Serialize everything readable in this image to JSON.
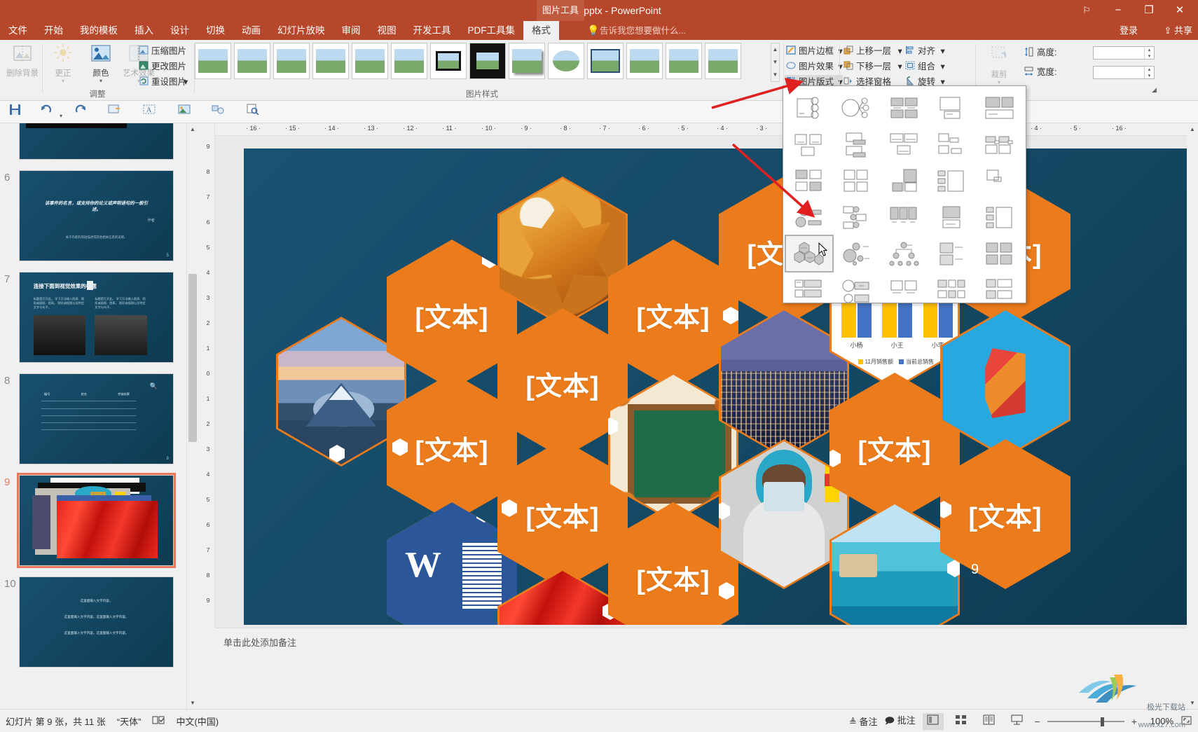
{
  "window": {
    "title": "PPT教程2.pptx - PowerPoint",
    "context_tab": "图片工具",
    "flag_icon": "flag-icon",
    "minimize": "−",
    "restore": "❐",
    "close": "✕"
  },
  "tabs": [
    {
      "label": "文件",
      "active": false
    },
    {
      "label": "开始",
      "active": false
    },
    {
      "label": "我的模板",
      "active": false
    },
    {
      "label": "插入",
      "active": false
    },
    {
      "label": "设计",
      "active": false
    },
    {
      "label": "切换",
      "active": false
    },
    {
      "label": "动画",
      "active": false
    },
    {
      "label": "幻灯片放映",
      "active": false
    },
    {
      "label": "审阅",
      "active": false
    },
    {
      "label": "视图",
      "active": false
    },
    {
      "label": "开发工具",
      "active": false
    },
    {
      "label": "PDF工具集",
      "active": false
    },
    {
      "label": "格式",
      "active": true
    }
  ],
  "tellme": "告诉我您想要做什么...",
  "account": "登录",
  "share": "共享",
  "share_icon": "share-icon",
  "ribbon": {
    "adjust_group": {
      "label": "调整",
      "remove_bg": {
        "label": "删除背景",
        "icon": "remove-background-icon"
      },
      "corrections": {
        "label": "更正",
        "icon": "corrections-icon"
      },
      "color": {
        "label": "颜色",
        "icon": "color-icon"
      },
      "artistic": {
        "label": "艺术效果",
        "icon": "artistic-effects-icon"
      },
      "compress": {
        "label": "压缩图片",
        "icon": "compress-picture-icon"
      },
      "change": {
        "label": "更改图片",
        "icon": "change-picture-icon"
      },
      "reset": {
        "label": "重设图片",
        "icon": "reset-picture-icon"
      }
    },
    "styles_group": {
      "label": "图片样式",
      "count": 14
    },
    "effects_group": {
      "border": {
        "label": "图片边框",
        "icon": "picture-border-icon"
      },
      "effects": {
        "label": "图片效果",
        "icon": "picture-effects-icon"
      },
      "layout": {
        "label": "图片版式",
        "icon": "picture-layout-icon",
        "active": true
      }
    },
    "arrange_group": {
      "bring_forward": {
        "label": "上移一层",
        "icon": "bring-forward-icon"
      },
      "send_backward": {
        "label": "下移一层",
        "icon": "send-backward-icon"
      },
      "selection_pane": {
        "label": "选择窗格",
        "icon": "selection-pane-icon"
      },
      "align": {
        "label": "对齐",
        "icon": "align-icon"
      },
      "group": {
        "label": "组合",
        "icon": "group-icon"
      },
      "rotate": {
        "label": "旋转",
        "icon": "rotate-icon"
      }
    },
    "size_group": {
      "crop": {
        "label": "裁剪",
        "icon": "crop-icon"
      },
      "height": {
        "label": "高度:",
        "value": "",
        "icon": "height-icon"
      },
      "width": {
        "label": "宽度:",
        "value": "",
        "icon": "width-icon"
      }
    }
  },
  "qat": [
    {
      "icon": "save-icon",
      "name": "save"
    },
    {
      "icon": "undo-icon",
      "name": "undo"
    },
    {
      "icon": "redo-icon",
      "name": "redo"
    },
    {
      "icon": "new-slide-icon",
      "name": "new-slide"
    },
    {
      "icon": "text-box-icon",
      "name": "text-box"
    },
    {
      "icon": "picture-icon",
      "name": "insert-picture"
    },
    {
      "icon": "shapes-icon",
      "name": "shapes"
    },
    {
      "icon": "preview-icon",
      "name": "print-preview"
    }
  ],
  "layout_dropdown": {
    "name": "picture-layout-gallery",
    "selected_index": 20,
    "items": [
      {
        "name": "accented-picture",
        "kind": "a"
      },
      {
        "name": "circular-picture-callout",
        "kind": "b"
      },
      {
        "name": "snapshot-picture-list",
        "kind": "c"
      },
      {
        "name": "picture-caption-list",
        "kind": "d"
      },
      {
        "name": "bending-picture-accent-list",
        "kind": "e"
      },
      {
        "name": "picture-strips",
        "kind": "f"
      },
      {
        "name": "captioned-pictures",
        "kind": "g"
      },
      {
        "name": "titled-picture-accent-list",
        "kind": "h"
      },
      {
        "name": "bubble-picture-list",
        "kind": "i"
      },
      {
        "name": "picture-accent-blocks",
        "kind": "j"
      },
      {
        "name": "alternating-picture-blocks",
        "kind": "k"
      },
      {
        "name": "picture-grid",
        "kind": "l"
      },
      {
        "name": "picture-lineup",
        "kind": "m"
      },
      {
        "name": "spiral-picture",
        "kind": "n"
      },
      {
        "name": "framed-text-picture",
        "kind": "o"
      },
      {
        "name": "radial-picture-list",
        "kind": "p"
      },
      {
        "name": "vertical-picture-list",
        "kind": "q"
      },
      {
        "name": "title-picture-lineup",
        "kind": "r"
      },
      {
        "name": "picture-caption-block",
        "kind": "s"
      },
      {
        "name": "vertical-picture-accent",
        "kind": "t"
      },
      {
        "name": "hexagon-radial",
        "kind": "u"
      },
      {
        "name": "circle-picture-hierarchy",
        "kind": "v"
      },
      {
        "name": "picture-organization-chart",
        "kind": "w"
      },
      {
        "name": "theme-picture-alternating",
        "kind": "x"
      },
      {
        "name": "theme-picture-grid",
        "kind": "y"
      },
      {
        "name": "continuous-picture-list",
        "kind": "z"
      },
      {
        "name": "bubble-picture-callout",
        "kind": "aa"
      },
      {
        "name": "picture-pair-list",
        "kind": "ab"
      },
      {
        "name": "nested-picture-blocks",
        "kind": "ac"
      },
      {
        "name": "picture-caption-stack",
        "kind": "ad"
      }
    ]
  },
  "slide_panel": {
    "thumbnails": [
      {
        "number": "5",
        "active": false,
        "kind": "dark-image"
      },
      {
        "number": "6",
        "active": false,
        "kind": "quote",
        "quote": "该事件的名言，或支持你的论义或声明语句的一般引述。",
        "author": "作者",
        "caption": "关于作者的简短描述或其他相关信息的说明。",
        "page": "5"
      },
      {
        "number": "7",
        "active": false,
        "kind": "two-photos",
        "title": "连接下面到视觉效果的标题",
        "sub1": "标题是打开此。 学下万法输入图表、图形或插图、图表。 图形或插图以及特定文字与句子。",
        "sub2": "标题是打开此。 学下万法输入图表、图形或插图、图表。 图形或插图以及特定文字与句子。"
      },
      {
        "number": "8",
        "active": false,
        "kind": "table",
        "headers": [
          "编号",
          "姓名",
          "考核结果"
        ],
        "page": "8"
      },
      {
        "number": "9",
        "active": true,
        "kind": "current"
      },
      {
        "number": "10",
        "active": false,
        "kind": "text-lines",
        "lines": [
          "这里面输入文字内容。",
          "这里面输入文字内容。这里面输入文字内容。",
          "这里面输入文字内容。这里面输入文字内容。"
        ]
      }
    ],
    "scroll_up": "▲",
    "scroll_down": "▼"
  },
  "rulers": {
    "horizontal_ticks": [
      "16",
      "15",
      "14",
      "13",
      "12",
      "11",
      "10",
      "9",
      "8",
      "7",
      "6",
      "5",
      "4",
      "3",
      "2",
      "1",
      "0",
      "1",
      "2",
      "3",
      "4",
      "5",
      "16"
    ],
    "vertical_ticks": [
      "9",
      "8",
      "7",
      "6",
      "5",
      "4",
      "3",
      "2",
      "1",
      "0",
      "1",
      "2",
      "3",
      "4",
      "5",
      "6",
      "7",
      "8",
      "9"
    ]
  },
  "slide": {
    "page_number": "9",
    "hexagons": [
      {
        "type": "image",
        "image": "mountain-fuji-photo",
        "name": "hex-picture-mountain"
      },
      {
        "type": "image",
        "image": "autumn-leaf-photo",
        "name": "hex-picture-leaf"
      },
      {
        "type": "text",
        "text": "[文本]",
        "name": "hex-text-1"
      },
      {
        "type": "text",
        "text": "[文本]",
        "name": "hex-text-2"
      },
      {
        "type": "text",
        "text": "[文本]",
        "name": "hex-text-3"
      },
      {
        "type": "text",
        "text": "[文本]",
        "name": "hex-text-4"
      },
      {
        "type": "text",
        "text": "[文本]",
        "name": "hex-text-5"
      },
      {
        "type": "text",
        "text": "[文本]",
        "name": "hex-text-6"
      },
      {
        "type": "text",
        "text": "[文本]",
        "name": "hex-text-7"
      },
      {
        "type": "text",
        "text": "[文本]",
        "name": "hex-text-8"
      },
      {
        "type": "text",
        "text": "[文本]",
        "name": "hex-text-9"
      },
      {
        "type": "image",
        "image": "city-night-photo",
        "name": "hex-picture-city"
      },
      {
        "type": "image",
        "image": "blackboard-autumn-photo",
        "name": "hex-picture-board"
      },
      {
        "type": "image",
        "image": "doctor-mask-photo",
        "name": "hex-picture-doctor"
      },
      {
        "type": "image",
        "image": "word-document-icon",
        "name": "hex-picture-word"
      },
      {
        "type": "image",
        "image": "red-silk-photo",
        "name": "hex-picture-silk"
      },
      {
        "type": "image",
        "image": "office-logo",
        "name": "hex-picture-office"
      },
      {
        "type": "image",
        "image": "beach-resort-photo",
        "name": "hex-picture-beach"
      },
      {
        "type": "image",
        "image": "sales-bar-chart",
        "name": "hex-picture-chart"
      }
    ]
  },
  "chart_data": {
    "type": "bar",
    "title": "",
    "categories": [
      "小杨",
      "小王",
      "小李"
    ],
    "series": [
      {
        "name": "11月销售额",
        "color": "#ffc000",
        "values": [
          62,
          74,
          55
        ]
      },
      {
        "name": "当前总销售",
        "color": "#4472c4",
        "values": [
          88,
          70,
          92
        ]
      }
    ],
    "xlabel": "",
    "ylabel": "",
    "ylim": [
      0,
      100
    ],
    "grid": false,
    "legend_position": "bottom"
  },
  "notes": {
    "placeholder": "单击此处添加备注"
  },
  "status": {
    "slide_info": "幻灯片 第 9 张，共 11 张",
    "theme": "“天体”",
    "spellcheck_icon": "spellcheck-icon",
    "language": "中文(中国)",
    "notes_btn": {
      "label": "备注",
      "icon": "notes-icon"
    },
    "comments_btn": {
      "label": "批注",
      "icon": "comments-icon"
    },
    "views": [
      {
        "icon": "normal-view-icon",
        "name": "normal-view",
        "active": true
      },
      {
        "icon": "slide-sorter-icon",
        "name": "slide-sorter",
        "active": false
      },
      {
        "icon": "reading-view-icon",
        "name": "reading-view",
        "active": false
      },
      {
        "icon": "slideshow-icon",
        "name": "slide-show",
        "active": false
      }
    ],
    "zoom_minus": "−",
    "zoom_plus": "+",
    "zoom_value": "100%",
    "fit_icon": "fit-to-window-icon"
  },
  "watermark": {
    "text": "极光下载站",
    "sub": "www.xz7.com"
  },
  "colors": {
    "ribbon_accent": "#b7472a",
    "hex_orange": "#ec7c1b",
    "slide_bg": "#134863",
    "arrow_red": "#e02020",
    "chart_yellow": "#ffc000",
    "chart_blue": "#4472c4"
  }
}
